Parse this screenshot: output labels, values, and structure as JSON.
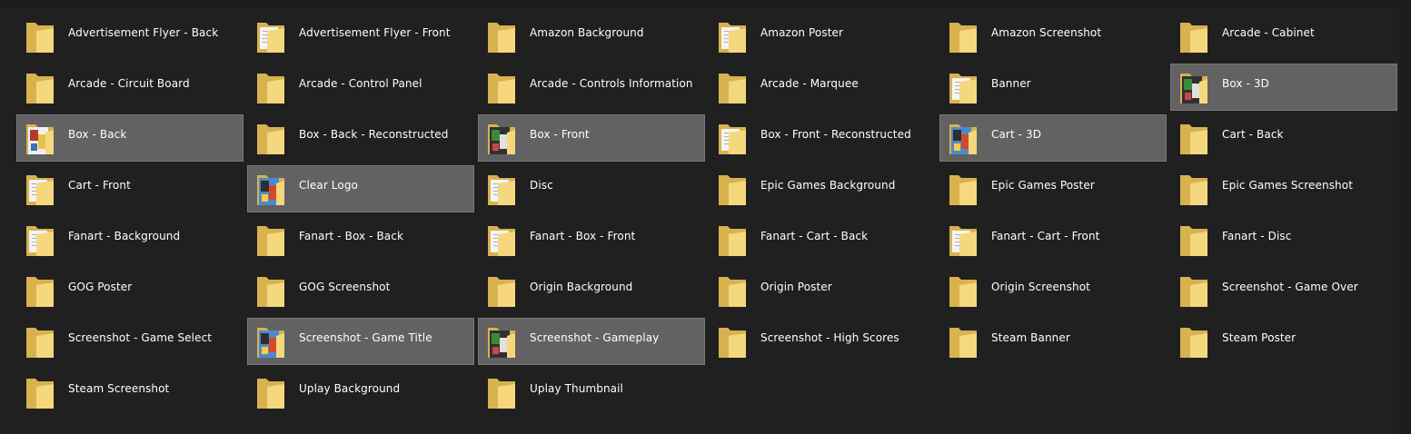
{
  "folder_icon": "folder-icon",
  "colors": {
    "background": "#202020",
    "selected_tile": "#626262",
    "folder": "#f5d77e",
    "label_text": "#ffffff"
  },
  "items": [
    {
      "label": "Advertisement Flyer - Back",
      "selected": false,
      "icon": "folder-icon"
    },
    {
      "label": "Advertisement Flyer - Front",
      "selected": false,
      "icon": "folder-with-documents-icon"
    },
    {
      "label": "Amazon Background",
      "selected": false,
      "icon": "folder-icon"
    },
    {
      "label": "Amazon Poster",
      "selected": false,
      "icon": "folder-with-documents-icon"
    },
    {
      "label": "Amazon Screenshot",
      "selected": false,
      "icon": "folder-icon"
    },
    {
      "label": "Arcade - Cabinet",
      "selected": false,
      "icon": "folder-icon"
    },
    {
      "label": "Arcade - Circuit Board",
      "selected": false,
      "icon": "folder-icon"
    },
    {
      "label": "Arcade - Control Panel",
      "selected": false,
      "icon": "folder-icon"
    },
    {
      "label": "Arcade - Controls Information",
      "selected": false,
      "icon": "folder-icon"
    },
    {
      "label": "Arcade - Marquee",
      "selected": false,
      "icon": "folder-icon"
    },
    {
      "label": "Banner",
      "selected": false,
      "icon": "folder-with-documents-icon"
    },
    {
      "label": "Box - 3D",
      "selected": true,
      "icon": "folder-with-image-icon"
    },
    {
      "label": "Box - Back",
      "selected": true,
      "icon": "folder-with-image-icon"
    },
    {
      "label": "Box - Back - Reconstructed",
      "selected": false,
      "icon": "folder-icon"
    },
    {
      "label": "Box - Front",
      "selected": true,
      "icon": "folder-with-image-icon"
    },
    {
      "label": "Box - Front - Reconstructed",
      "selected": false,
      "icon": "folder-with-documents-icon"
    },
    {
      "label": "Cart - 3D",
      "selected": true,
      "icon": "folder-with-image-icon"
    },
    {
      "label": "Cart - Back",
      "selected": false,
      "icon": "folder-icon"
    },
    {
      "label": "Cart - Front",
      "selected": false,
      "icon": "folder-with-documents-icon"
    },
    {
      "label": "Clear Logo",
      "selected": true,
      "icon": "folder-with-image-icon"
    },
    {
      "label": "Disc",
      "selected": false,
      "icon": "folder-with-documents-icon"
    },
    {
      "label": "Epic Games Background",
      "selected": false,
      "icon": "folder-icon"
    },
    {
      "label": "Epic Games Poster",
      "selected": false,
      "icon": "folder-icon"
    },
    {
      "label": "Epic Games Screenshot",
      "selected": false,
      "icon": "folder-icon"
    },
    {
      "label": "Fanart - Background",
      "selected": false,
      "icon": "folder-with-documents-icon"
    },
    {
      "label": "Fanart - Box - Back",
      "selected": false,
      "icon": "folder-icon"
    },
    {
      "label": "Fanart - Box - Front",
      "selected": false,
      "icon": "folder-with-documents-icon"
    },
    {
      "label": "Fanart - Cart - Back",
      "selected": false,
      "icon": "folder-icon"
    },
    {
      "label": "Fanart - Cart - Front",
      "selected": false,
      "icon": "folder-with-documents-icon"
    },
    {
      "label": "Fanart - Disc",
      "selected": false,
      "icon": "folder-icon"
    },
    {
      "label": "GOG Poster",
      "selected": false,
      "icon": "folder-icon"
    },
    {
      "label": "GOG Screenshot",
      "selected": false,
      "icon": "folder-icon"
    },
    {
      "label": "Origin Background",
      "selected": false,
      "icon": "folder-icon"
    },
    {
      "label": "Origin Poster",
      "selected": false,
      "icon": "folder-icon"
    },
    {
      "label": "Origin Screenshot",
      "selected": false,
      "icon": "folder-icon"
    },
    {
      "label": "Screenshot - Game Over",
      "selected": false,
      "icon": "folder-icon"
    },
    {
      "label": "Screenshot - Game Select",
      "selected": false,
      "icon": "folder-icon"
    },
    {
      "label": "Screenshot - Game Title",
      "selected": true,
      "icon": "folder-with-image-icon"
    },
    {
      "label": "Screenshot - Gameplay",
      "selected": true,
      "icon": "folder-with-image-icon"
    },
    {
      "label": "Screenshot - High Scores",
      "selected": false,
      "icon": "folder-icon"
    },
    {
      "label": "Steam Banner",
      "selected": false,
      "icon": "folder-icon"
    },
    {
      "label": "Steam Poster",
      "selected": false,
      "icon": "folder-icon"
    },
    {
      "label": "Steam Screenshot",
      "selected": false,
      "icon": "folder-icon"
    },
    {
      "label": "Uplay Background",
      "selected": false,
      "icon": "folder-icon"
    },
    {
      "label": "Uplay Thumbnail",
      "selected": false,
      "icon": "folder-icon"
    }
  ]
}
